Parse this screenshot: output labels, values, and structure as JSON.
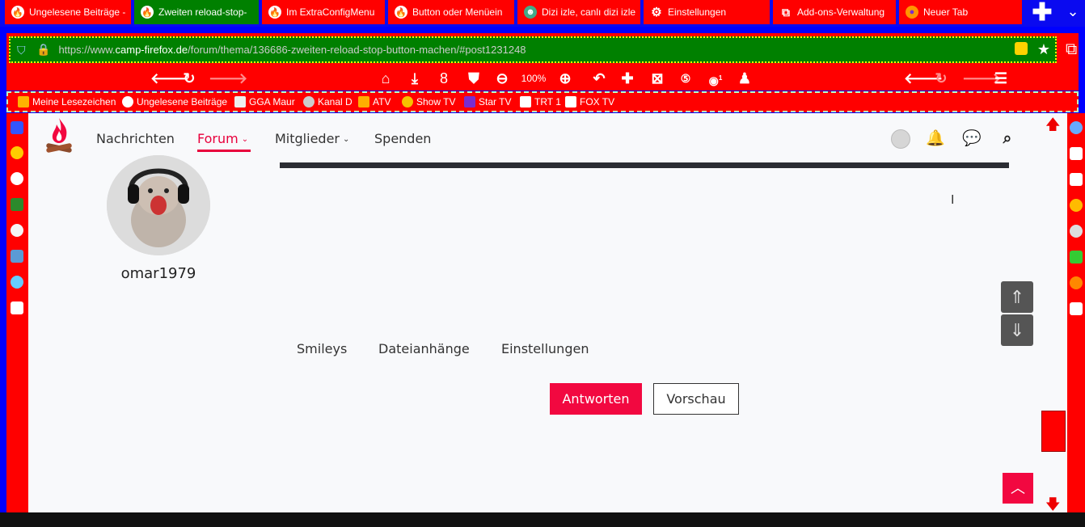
{
  "tabs": [
    {
      "label": "Ungelesene Beiträge -",
      "icon": "firefox-forum-icon",
      "active": false
    },
    {
      "label": "Zweiten reload-stop-",
      "icon": "firefox-forum-icon",
      "active": true
    },
    {
      "label": "Im ExtraConfigMenu",
      "icon": "firefox-forum-icon",
      "active": false
    },
    {
      "label": "Button oder Menüein",
      "icon": "firefox-forum-icon",
      "active": false
    },
    {
      "label": "Dizi izle, canlı dizi izle",
      "icon": "dizi-icon",
      "active": false
    },
    {
      "label": "Einstellungen",
      "icon": "gear-icon",
      "active": false
    },
    {
      "label": "Add-ons-Verwaltung",
      "icon": "puzzle-icon",
      "active": false
    },
    {
      "label": "Neuer Tab",
      "icon": "firefox-icon",
      "active": false
    }
  ],
  "newtab_symbol": "✚",
  "tablist_symbol": "⌄",
  "urlbar": {
    "prefix": "https://www.",
    "domain": "camp-firefox.de",
    "path": "/forum/thema/136686-zweiten-reload-stop-button-machen/#post1231248"
  },
  "toolbar": {
    "zoom": "100%",
    "downloads_count": "8",
    "ublock_badge": "1"
  },
  "bookmarks": [
    {
      "label": "Meine Lesezeichen",
      "icon": "folder-icon"
    },
    {
      "label": "Ungelesene Beiträge",
      "icon": "firefox-forum-icon"
    },
    {
      "label": "GGA Maur",
      "icon": "gga-icon"
    },
    {
      "label": "Kanal D",
      "icon": "kanald-icon"
    },
    {
      "label": "ATV",
      "icon": "atv-icon"
    },
    {
      "label": "Show TV",
      "icon": "showtv-icon"
    },
    {
      "label": "Star TV",
      "icon": "startv-icon"
    },
    {
      "label": "TRT 1",
      "icon": "trt1-icon"
    },
    {
      "label": "FOX TV",
      "icon": "fox-icon"
    }
  ],
  "site_nav": {
    "items": [
      {
        "label": "Nachrichten",
        "dropdown": false,
        "active": false
      },
      {
        "label": "Forum",
        "dropdown": true,
        "active": true
      },
      {
        "label": "Mitglieder",
        "dropdown": true,
        "active": false
      },
      {
        "label": "Spenden",
        "dropdown": false,
        "active": false
      }
    ],
    "chevron": "⌄"
  },
  "post": {
    "username": "omar1979"
  },
  "editor_tabs": [
    "Smileys",
    "Dateianhänge",
    "Einstellungen"
  ],
  "buttons": {
    "reply": "Antworten",
    "preview": "Vorschau"
  },
  "colors": {
    "accent": "#f20840",
    "chrome_red": "#ff0000",
    "active_tab_green": "#008000",
    "frame_blue": "#0000ff"
  }
}
